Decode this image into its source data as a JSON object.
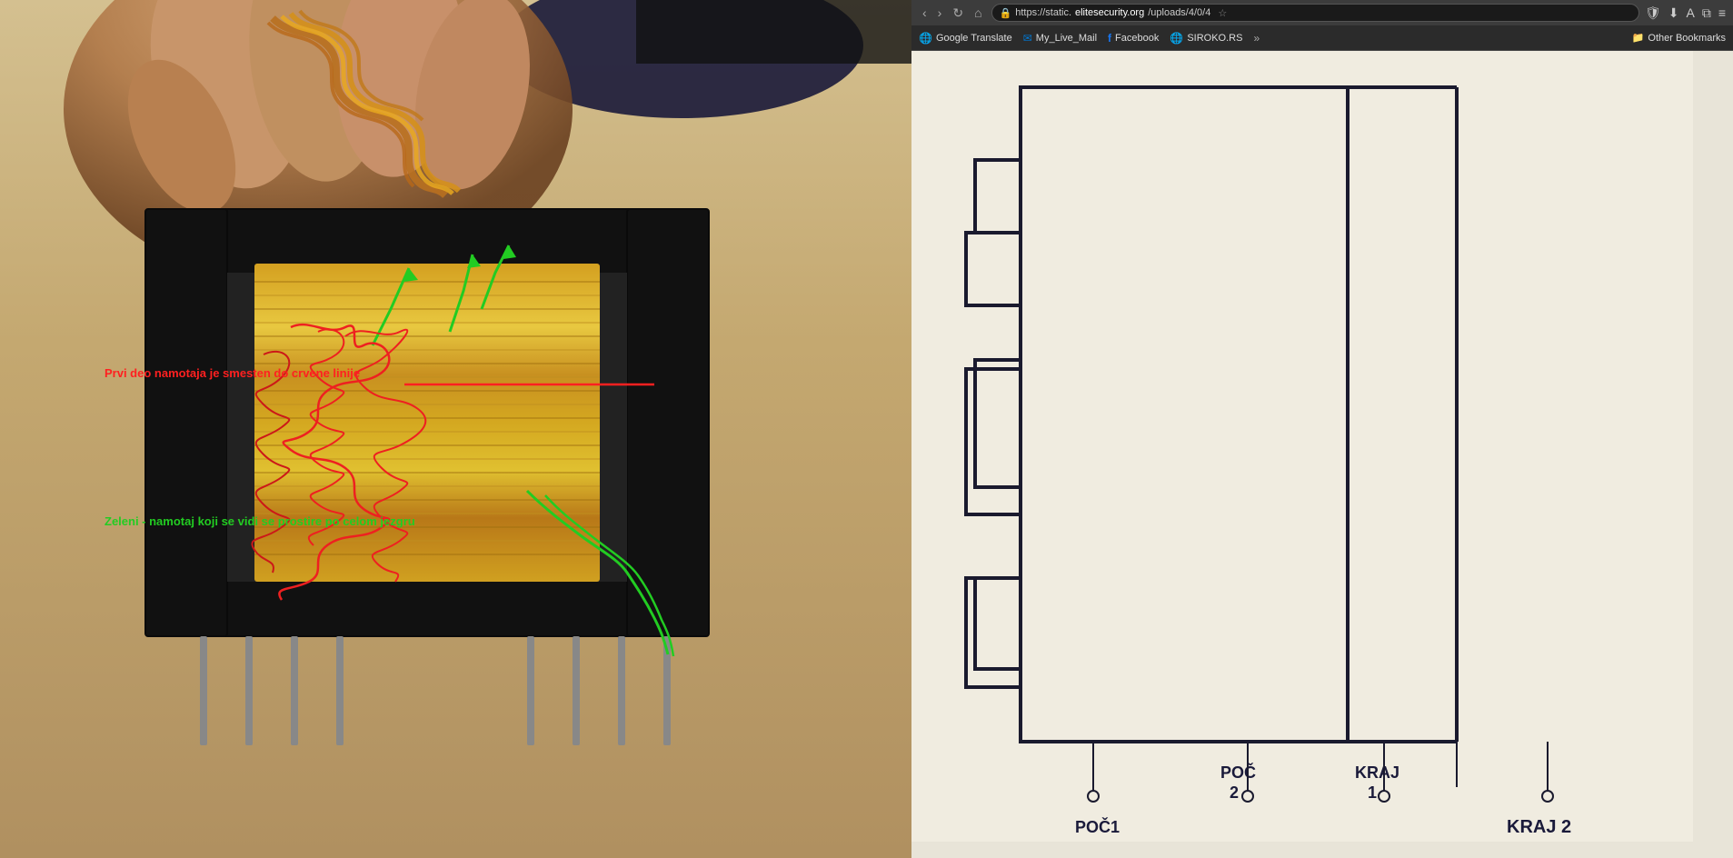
{
  "browser": {
    "url": {
      "prefix": "https://static.",
      "highlight": "elitesecurity.org",
      "suffix": "/uploads/4/0/4"
    },
    "bookmarks": [
      {
        "label": "Google Translate",
        "icon": "🌐",
        "color": "#4285F4"
      },
      {
        "label": "My_Live_Mail",
        "icon": "✉",
        "color": "#0078d4"
      },
      {
        "label": "Facebook",
        "icon": "f",
        "color": "#1877F2"
      },
      {
        "label": "SIROKO.RS",
        "icon": "🌐",
        "color": "#333"
      }
    ],
    "bookmarks_more": "»",
    "other_bookmarks_label": "Other Bookmarks"
  },
  "annotations": {
    "red_text": "Prvi deo namotaja je smesten do crvene linije",
    "green_text": "Zeleni - namotaj koji se vidi se prostire po celom jezgru"
  },
  "diagram": {
    "labels": {
      "poc1": "POČ1",
      "poc2": "POČ\n2",
      "kraj1": "KRAJ\n1",
      "kraj2": "KRAJ 2"
    }
  },
  "progress": {
    "width_percent": 40
  }
}
